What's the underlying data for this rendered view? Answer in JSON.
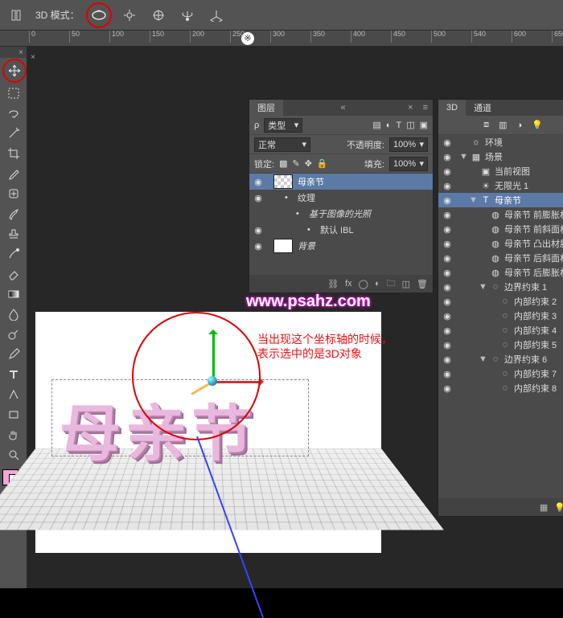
{
  "options_bar": {
    "mode_label": "3D 模式：",
    "icons": [
      "orbit-icon",
      "pan-icon",
      "move-3d-icon",
      "rotate-3d-icon",
      "scale-3d-icon"
    ]
  },
  "ruler": {
    "tick_labels": [
      "0",
      "50",
      "100",
      "150",
      "200",
      "250",
      "300",
      "350",
      "400",
      "450",
      "500",
      "540",
      "600",
      "650"
    ],
    "marker": "※"
  },
  "doc_tab": {
    "close": "×"
  },
  "layers_panel": {
    "tab": "图层",
    "filter_label": "类型",
    "blend_mode": "正常",
    "opacity_label": "不透明度:",
    "opacity_value": "100%",
    "lock_label": "锁定:",
    "fill_label": "填充:",
    "fill_value": "100%",
    "items": [
      {
        "eye": "◉",
        "name": "母亲节",
        "sel": true,
        "indent": 0,
        "thumb": true
      },
      {
        "eye": "◉",
        "name": "纹理",
        "sel": false,
        "indent": 1,
        "thumb": false
      },
      {
        "eye": "",
        "name": "基于图像的光照",
        "sel": false,
        "indent": 2,
        "thumb": false,
        "italic": true
      },
      {
        "eye": "◉",
        "name": "默认 IBL",
        "sel": false,
        "indent": 3,
        "thumb": false
      },
      {
        "eye": "◉",
        "name": "背景",
        "sel": false,
        "indent": 0,
        "thumb": true,
        "bg": "#fff",
        "italic": true
      }
    ]
  },
  "p3d_panel": {
    "tabs": [
      "3D",
      "通道"
    ],
    "active_tab": 0,
    "tree": [
      {
        "eye": "◉",
        "tw": "",
        "ic": "☼",
        "lbl": "环境",
        "d": 0
      },
      {
        "eye": "◉",
        "tw": "▼",
        "ic": "▦",
        "lbl": "场景",
        "d": 0
      },
      {
        "eye": "◉",
        "tw": "",
        "ic": "▣",
        "lbl": "当前视图",
        "d": 1
      },
      {
        "eye": "◉",
        "tw": "",
        "ic": "☀",
        "lbl": "无限光 1",
        "d": 1
      },
      {
        "eye": "◉",
        "tw": "▼",
        "ic": "T",
        "lbl": "母亲节",
        "d": 1,
        "sel": true
      },
      {
        "eye": "◉",
        "tw": "",
        "ic": "◍",
        "lbl": "母亲节 前膨胀材质",
        "d": 2
      },
      {
        "eye": "◉",
        "tw": "",
        "ic": "◍",
        "lbl": "母亲节 前斜面材质",
        "d": 2
      },
      {
        "eye": "◉",
        "tw": "",
        "ic": "◍",
        "lbl": "母亲节 凸出材质",
        "d": 2
      },
      {
        "eye": "◉",
        "tw": "",
        "ic": "◍",
        "lbl": "母亲节 后斜面材质",
        "d": 2
      },
      {
        "eye": "◉",
        "tw": "",
        "ic": "◍",
        "lbl": "母亲节 后膨胀材质",
        "d": 2
      },
      {
        "eye": "◉",
        "tw": "▼",
        "ic": "◌",
        "lbl": "边界约束 1",
        "d": 2
      },
      {
        "eye": "◉",
        "tw": "",
        "ic": "◌",
        "lbl": "内部约束 2",
        "d": 3
      },
      {
        "eye": "◉",
        "tw": "",
        "ic": "◌",
        "lbl": "内部约束 3",
        "d": 3
      },
      {
        "eye": "◉",
        "tw": "",
        "ic": "◌",
        "lbl": "内部约束 4",
        "d": 3
      },
      {
        "eye": "◉",
        "tw": "",
        "ic": "◌",
        "lbl": "内部约束 5",
        "d": 3
      },
      {
        "eye": "◉",
        "tw": "▼",
        "ic": "◌",
        "lbl": "边界约束 6",
        "d": 2
      },
      {
        "eye": "◉",
        "tw": "",
        "ic": "◌",
        "lbl": "内部约束 7",
        "d": 3
      },
      {
        "eye": "◉",
        "tw": "",
        "ic": "◌",
        "lbl": "内部约束 8",
        "d": 3
      }
    ]
  },
  "canvas": {
    "text3d": "母亲节",
    "watermark": "www.psahz.com",
    "annotation_l1": "当出现这个坐标轴的时候，",
    "annotation_l2": "表示选中的是3D对象"
  },
  "tools": {
    "list": [
      "move",
      "marquee",
      "lasso",
      "wand",
      "crop",
      "eyedrop",
      "heal",
      "brush",
      "stamp",
      "history",
      "eraser",
      "gradient",
      "blur",
      "dodge",
      "pen",
      "type",
      "path",
      "rect",
      "hand",
      "zoom"
    ]
  }
}
